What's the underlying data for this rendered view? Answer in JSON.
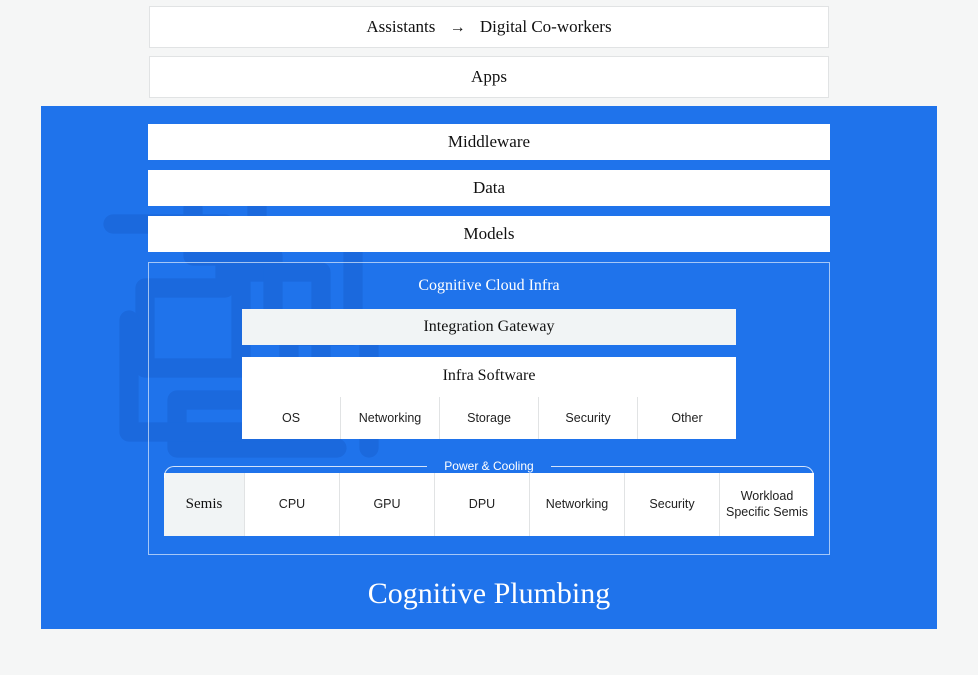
{
  "top": {
    "assistants_label": "Assistants",
    "arrow_glyph": "→",
    "coworkers_label": "Digital Co-workers",
    "apps_label": "Apps"
  },
  "blue": {
    "middleware": "Middleware",
    "data": "Data",
    "models": "Models",
    "cloud_infra_title": "Cognitive Cloud Infra",
    "integration_gateway": "Integration Gateway",
    "infra_software_title": "Infra Software",
    "infra_software_items": {
      "os": "OS",
      "networking": "Networking",
      "storage": "Storage",
      "security": "Security",
      "other": "Other"
    },
    "power_cooling": "Power & Cooling",
    "semis_label": "Semis",
    "semis_items": {
      "cpu": "CPU",
      "gpu": "GPU",
      "dpu": "DPU",
      "networking": "Networking",
      "security": "Security",
      "workload": "Workload Specific Semis"
    },
    "title": "Cognitive Plumbing"
  }
}
